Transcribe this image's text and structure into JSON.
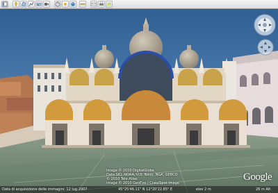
{
  "toolbar": {
    "buttons": [
      {
        "icon": "sidebar-icon"
      },
      {
        "icon": "placemark-icon"
      },
      {
        "icon": "polygon-icon"
      },
      {
        "icon": "path-icon"
      },
      {
        "icon": "image-overlay-icon"
      },
      {
        "icon": "record-tour-icon"
      },
      {
        "icon": "historical-imagery-icon"
      },
      {
        "icon": "sunlight-icon"
      },
      {
        "icon": "sky-icon"
      },
      {
        "icon": "ruler-icon"
      },
      {
        "icon": "email-icon"
      },
      {
        "icon": "print-icon"
      },
      {
        "icon": "view-in-maps-icon"
      }
    ]
  },
  "credits": {
    "line1": "Image © 2010 DigitalGlobe",
    "line2": "Data SIO, NOAA, U.S. Navy, NGA, GEBCO",
    "line3": "© 2010 Tele Atlas",
    "line4": "Image © 2010 GeoEye / Cnes/Spot Image"
  },
  "logo": {
    "text": "Google"
  },
  "statusbar": {
    "imagery_date": "Data di acquisizione delle immagini: 12 lug 2007",
    "coords": "45°25'46.11\" N   12°20'22.85\" E",
    "elevation": "elev  2 m",
    "eye_alt": "26 m  Alt"
  },
  "colors": {
    "sky_top": "#2f5f93",
    "sky_bottom": "#6f9cc9",
    "facade": "#e8ded0",
    "dome": "#b3a998",
    "plaza": "#7e9280"
  }
}
